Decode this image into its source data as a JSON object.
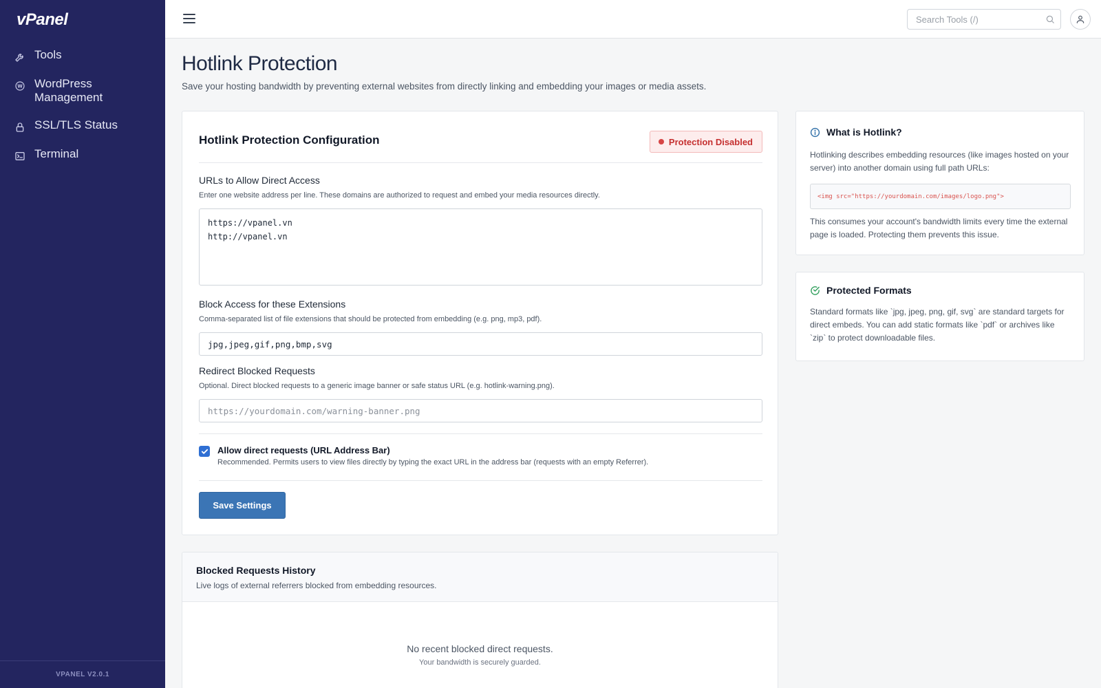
{
  "app": {
    "logo": "vPanel",
    "version": "VPANEL V2.0.1"
  },
  "sidebar": {
    "items": [
      {
        "label": "Tools",
        "icon": "wrench-icon"
      },
      {
        "label": "WordPress Management",
        "icon": "wordpress-icon"
      },
      {
        "label": "SSL/TLS Status",
        "icon": "lock-icon"
      },
      {
        "label": "Terminal",
        "icon": "terminal-icon"
      }
    ]
  },
  "topbar": {
    "search_placeholder": "Search Tools (/)",
    "search_value": ""
  },
  "page": {
    "title": "Hotlink Protection",
    "subtitle": "Save your hosting bandwidth by preventing external websites from directly linking and embedding your images or media assets."
  },
  "config": {
    "title": "Hotlink Protection Configuration",
    "status_badge": "Protection Disabled",
    "allowed_urls": {
      "label": "URLs to Allow Direct Access",
      "help": "Enter one website address per line. These domains are authorized to request and embed your media resources directly.",
      "value": "https://vpanel.vn\nhttp://vpanel.vn"
    },
    "extensions": {
      "label": "Block Access for these Extensions",
      "help": "Comma-separated list of file extensions that should be protected from embedding (e.g. png, mp3, pdf).",
      "value": "jpg,jpeg,gif,png,bmp,svg"
    },
    "redirect": {
      "label": "Redirect Blocked Requests",
      "help": "Optional. Direct blocked requests to a generic image banner or safe status URL (e.g. hotlink-warning.png).",
      "placeholder": "https://yourdomain.com/warning-banner.png",
      "value": ""
    },
    "allow_direct": {
      "label": "Allow direct requests (URL Address Bar)",
      "help": "Recommended. Permits users to view files directly by typing the exact URL in the address bar (requests with an empty Referrer).",
      "checked": true
    },
    "save_label": "Save Settings"
  },
  "history": {
    "title": "Blocked Requests History",
    "subtitle": "Live logs of external referrers blocked from embedding resources.",
    "empty_title": "No recent blocked direct requests.",
    "empty_subtitle": "Your bandwidth is securely guarded."
  },
  "info": {
    "what_is": {
      "title": "What is Hotlink?",
      "text1": "Hotlinking describes embedding resources (like images hosted on your server) into another domain using full path URLs:",
      "code": "<img src=\"https://yourdomain.com/images/logo.png\">",
      "text2": "This consumes your account's bandwidth limits every time the external page is loaded. Protecting them prevents this issue."
    },
    "formats": {
      "title": "Protected Formats",
      "text": "Standard formats like `jpg, jpeg, png, gif, svg` are standard targets for direct embeds. You can add static formats like `pdf` or archives like `zip` to protect downloadable files."
    }
  },
  "colors": {
    "sidebar_bg": "#23255f",
    "accent": "#3b75b5",
    "danger": "#c53030",
    "success": "#2f9e5b",
    "info": "#2f6fa8"
  }
}
